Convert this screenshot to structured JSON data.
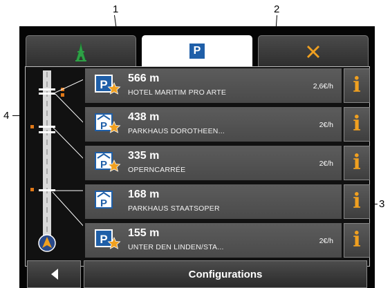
{
  "callouts": [
    "1",
    "2",
    "3",
    "4"
  ],
  "tabs": [
    {
      "icon": "eiffel-tower-icon",
      "label": ""
    },
    {
      "icon": "parking-icon",
      "label": "P"
    },
    {
      "icon": "close-icon",
      "label": ""
    }
  ],
  "parking_list": [
    {
      "distance": "566 m",
      "name": "HOTEL MARITIM PRO ARTE",
      "price": "2,6€/h",
      "icon": "parking-favorite-icon"
    },
    {
      "distance": "438 m",
      "name": "PARKHAUS DOROTHEEN...",
      "price": "2€/h",
      "icon": "parking-garage-favorite-icon"
    },
    {
      "distance": "335 m",
      "name": "OPERNCARRÉE",
      "price": "2€/h",
      "icon": "parking-garage-favorite-icon"
    },
    {
      "distance": "168 m",
      "name": "PARKHAUS STAATSOPER",
      "price": "",
      "icon": "parking-garage-icon"
    },
    {
      "distance": "155 m",
      "name": "UNTER DEN LINDEN/STA...",
      "price": "2€/h",
      "icon": "parking-favorite-icon"
    }
  ],
  "info_label": "i",
  "footer": {
    "back_icon": "back-arrow-icon",
    "config_label": "Configurations"
  },
  "colors": {
    "accent_orange": "#f0a020",
    "parking_blue": "#1f5fa8",
    "row_gray": "#555555"
  }
}
